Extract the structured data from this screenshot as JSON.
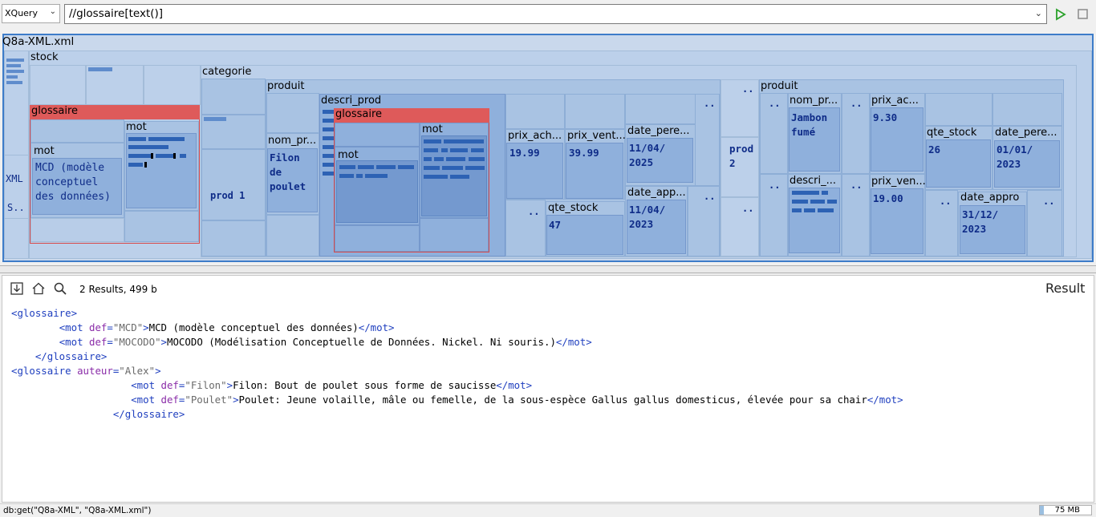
{
  "toolbar": {
    "mode": "XQuery",
    "query": "//glossaire[text()]"
  },
  "map": {
    "file": "Q8a-XML.xml",
    "stock": "stock",
    "glossaire": "glossaire",
    "mot": "mot",
    "categorie": "categorie",
    "produit": "produit",
    "descri_prod": "descri_prod",
    "nom_pr_short": "nom_pr...",
    "nom_pr_short2": "nom_pr...",
    "prix_ach": "prix_ach...",
    "prix_vent": "prix_vent...",
    "date_pere": "date_pere...",
    "date_app": "date_app...",
    "qte_stock": "qte_stock",
    "prix_ac": "prix_ac...",
    "descri_short": "descri_...",
    "prix_ven": "prix_ven...",
    "date_pere2": "date_pere...",
    "date_appro": "date_appro",
    "xml_label": "XML",
    "s_label": "S..",
    "dots": "..",
    "mcd_value": "MCD (modèle\nconceptuel\ndes données)",
    "prod1": "prod 1",
    "filon": "Filon\nde\npoulet",
    "v_1999": "19.99",
    "v_3999": "39.99",
    "v_date1": "11/04/\n2025",
    "v_qte1": "47",
    "v_date2": "11/04/\n2023",
    "prod2": "prod\n2",
    "jambon": "Jambon\nfumé",
    "v_930": "9.30",
    "v_26": "26",
    "v_date3": "01/01/\n2023",
    "v_1900": "19.00",
    "v_date4": "31/12/\n2023"
  },
  "results": {
    "count": "2 Results, 499 b",
    "title": "Result",
    "lines": [
      {
        "indent": "",
        "parts": [
          [
            "tag",
            "<glossaire>"
          ]
        ]
      },
      {
        "indent": "        ",
        "parts": [
          [
            "tag",
            "<mot "
          ],
          [
            "attr",
            "def"
          ],
          [
            "tag",
            "="
          ],
          [
            "str",
            "\"MCD\""
          ],
          [
            "tag",
            ">"
          ],
          [
            "text",
            "MCD (modèle conceptuel des données)"
          ],
          [
            "tag",
            "</mot>"
          ]
        ]
      },
      {
        "indent": "        ",
        "parts": [
          [
            "tag",
            "<mot "
          ],
          [
            "attr",
            "def"
          ],
          [
            "tag",
            "="
          ],
          [
            "str",
            "\"MOCODO\""
          ],
          [
            "tag",
            ">"
          ],
          [
            "text",
            "MOCODO (Modélisation Conceptuelle de Données. Nickel. Ni souris.)"
          ],
          [
            "tag",
            "</mot>"
          ]
        ]
      },
      {
        "indent": "    ",
        "parts": [
          [
            "tag",
            "</glossaire>"
          ]
        ]
      },
      {
        "indent": "",
        "parts": [
          [
            "tag",
            "<glossaire "
          ],
          [
            "attr",
            "auteur"
          ],
          [
            "tag",
            "="
          ],
          [
            "str",
            "\"Alex\""
          ],
          [
            "tag",
            ">"
          ]
        ]
      },
      {
        "indent": "                    ",
        "parts": [
          [
            "tag",
            "<mot "
          ],
          [
            "attr",
            "def"
          ],
          [
            "tag",
            "="
          ],
          [
            "str",
            "\"Filon\""
          ],
          [
            "tag",
            ">"
          ],
          [
            "text",
            "Filon: Bout de poulet sous forme de saucisse"
          ],
          [
            "tag",
            "</mot>"
          ]
        ]
      },
      {
        "indent": "                    ",
        "parts": [
          [
            "tag",
            "<mot "
          ],
          [
            "attr",
            "def"
          ],
          [
            "tag",
            "="
          ],
          [
            "str",
            "\"Poulet\""
          ],
          [
            "tag",
            ">"
          ],
          [
            "text",
            "Poulet: Jeune volaille, mâle ou femelle, de la sous-espèce Gallus gallus domesticus, élevée pour sa chair"
          ],
          [
            "tag",
            "</mot>"
          ]
        ]
      },
      {
        "indent": "                 ",
        "parts": [
          [
            "tag",
            "</glossaire>"
          ]
        ]
      }
    ]
  },
  "status": {
    "command": "db:get(\"Q8a-XML\", \"Q8a-XML.xml\")",
    "memory": "75 MB",
    "memory_used_fraction": 0.08
  },
  "colors": {
    "accent": "#3d7cc9",
    "highlight": "#de5a5a",
    "tag": "#1f3fbf",
    "attr": "#8a2ca8"
  }
}
